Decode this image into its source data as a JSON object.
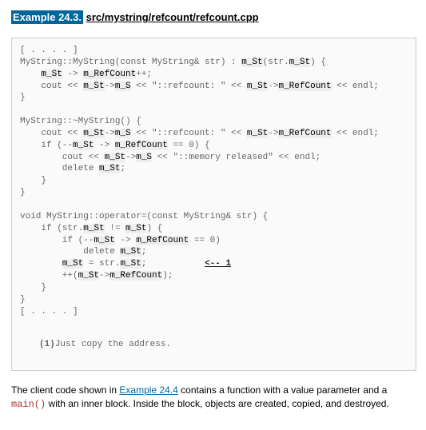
{
  "heading": {
    "number": "Example 24.3.",
    "file": "src/mystring/refcount/refcount.cpp"
  },
  "code": {
    "l01a": "[ . . . . ]",
    "l02a": "MyString::MyString(const MyString& str) : ",
    "l02b": "m_St",
    "l02c": "(str.",
    "l02d": "m_St",
    "l02e": ") {",
    "l03a": "    ",
    "l03b": "m_St",
    "l03c": " -> ",
    "l03d": "m_RefCount",
    "l03e": "++;",
    "l04a": "    cout << ",
    "l04b": "m_St",
    "l04c": "->",
    "l04d": "m_S",
    "l04e": " << \"::refcount: \" << ",
    "l04f": "m_St",
    "l04g": "->",
    "l04h": "m_RefCount",
    "l04i": " << endl;",
    "l05a": "}",
    "blank1": "",
    "l06a": "MyString::~MyString() {",
    "l07a": "    cout << ",
    "l07b": "m_St",
    "l07c": "->",
    "l07d": "m_S",
    "l07e": " << \"::refcount: \" << ",
    "l07f": "m_St",
    "l07g": "->",
    "l07h": "m_RefCount",
    "l07i": " << endl;",
    "l08a": "    if (--",
    "l08b": "m_St",
    "l08c": " -> ",
    "l08d": "m_RefCount",
    "l08e": " == 0) {",
    "l09a": "        cout << ",
    "l09b": "m_St",
    "l09c": "->",
    "l09d": "m_S",
    "l09e": " << \"::memory released\" << endl;",
    "l10a": "        delete ",
    "l10b": "m_St",
    "l10c": ";",
    "l11a": "    }",
    "l12a": "}",
    "blank2": "",
    "l13a": "void MyString::operator=(const MyString& str) {",
    "l14a": "    if (str.",
    "l14b": "m_St",
    "l14c": " != ",
    "l14d": "m_St",
    "l14e": ") {",
    "l15a": "        if (--",
    "l15b": "m_St",
    "l15c": " -> ",
    "l15d": "m_RefCount",
    "l15e": " == 0)",
    "l16a": "            delete ",
    "l16b": "m_St",
    "l16c": ";",
    "l17a": "        ",
    "l17b": "m_St",
    "l17c": " = str.",
    "l17d": "m_St",
    "l17e": ";           ",
    "l17annot": "<-- 1",
    "l18a": "        ++(",
    "l18b": "m_St",
    "l18c": "->",
    "l18d": "m_RefCount",
    "l18e": ");",
    "l19a": "    }",
    "l20a": "}",
    "l21a": "[ . . . . ]"
  },
  "footnote": {
    "num": "(1)",
    "text": "Just copy the address."
  },
  "paragraph": {
    "t1": "The client code shown in ",
    "link": "Example 24.4",
    "t2": " contains a function with a value parameter and a ",
    "fn": "main()",
    "t3": " with an inner block. Inside the block, objects are created, copied, and destroyed."
  }
}
